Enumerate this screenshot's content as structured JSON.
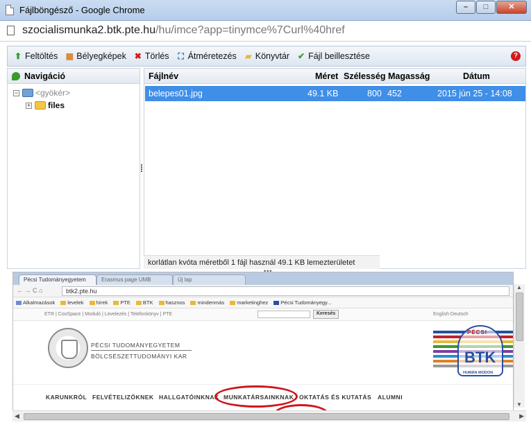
{
  "window": {
    "title": "Fájlböngésző - Google Chrome",
    "buttons": {
      "minimize": "–",
      "maximize": "□",
      "close": "✕"
    }
  },
  "address": {
    "host": "szocialismunka2.btk.pte.hu",
    "path": "/hu/imce?app=tinymce%7Curl%40href"
  },
  "toolbar": {
    "items": [
      {
        "label": "Feltöltés",
        "icon": "upload-icon",
        "color": "#3b9a2e"
      },
      {
        "label": "Bélyegképek",
        "icon": "thumbnails-icon",
        "color": "#d9822b"
      },
      {
        "label": "Törlés",
        "icon": "delete-icon",
        "color": "#d21a1a"
      },
      {
        "label": "Átméretezés",
        "icon": "resize-icon",
        "color": "#2a6fb8"
      },
      {
        "label": "Könyvtár",
        "icon": "folder-add-icon",
        "color": "#e8b838"
      },
      {
        "label": "Fájl beillesztése",
        "icon": "insert-file-icon",
        "color": "#3b9a2e"
      }
    ],
    "help": "?"
  },
  "navigation": {
    "header": "Navigáció",
    "root": "<gyökér>",
    "root_toggle": "−",
    "folder": "files",
    "folder_toggle": "+"
  },
  "filelist": {
    "columns": {
      "name": "Fájlnév",
      "size": "Méret",
      "width": "Szélesség",
      "height": "Magasság",
      "date": "Dátum"
    },
    "rows": [
      {
        "name": "belepes01.jpg",
        "size": "49.1 KB",
        "width": "800",
        "height": "452",
        "date": "2015 jún 25 - 14:08"
      }
    ],
    "status": "korlátlan kvóta méretből 1 fájl használ 49.1 KB lemezterületet"
  },
  "preview": {
    "tabs": [
      "Pécsi Tudományegyetem",
      "Erasmus page UMB",
      "Új lap"
    ],
    "url": "btk2.pte.hu",
    "bookmarks": [
      "Alkalmazások",
      "levelek",
      "hírek",
      "PTE",
      "BTK",
      "hasznos",
      "mindenmás",
      "marketinghez",
      "Pécsi Tudományegy..."
    ],
    "toplinks": "ETR  |  CooSpace  |  Moduló  |  Levelezés  |  Telefonkönyv  |  PTE",
    "search_button": "Keresés",
    "langs": "English  Deutsch",
    "university": "PÉCSI TUDOMÁNYEGYETEM",
    "faculty": "BÖLCSÉSZETTUDOMÁNYI KAR",
    "logo_top": "PÉCSI",
    "logo_main": "BTK",
    "logo_bottom": "HUMÁN MODON",
    "menu": [
      "KARUNKRÓL",
      "FELVÉTELIZŐKNEK",
      "HALLGATÓINKNAK",
      "MUNKATÁRSAINKNAK",
      "OKTATÁS ÉS KUTATÁS",
      "ALUMNI"
    ],
    "highlight_color": "#d0141a"
  }
}
